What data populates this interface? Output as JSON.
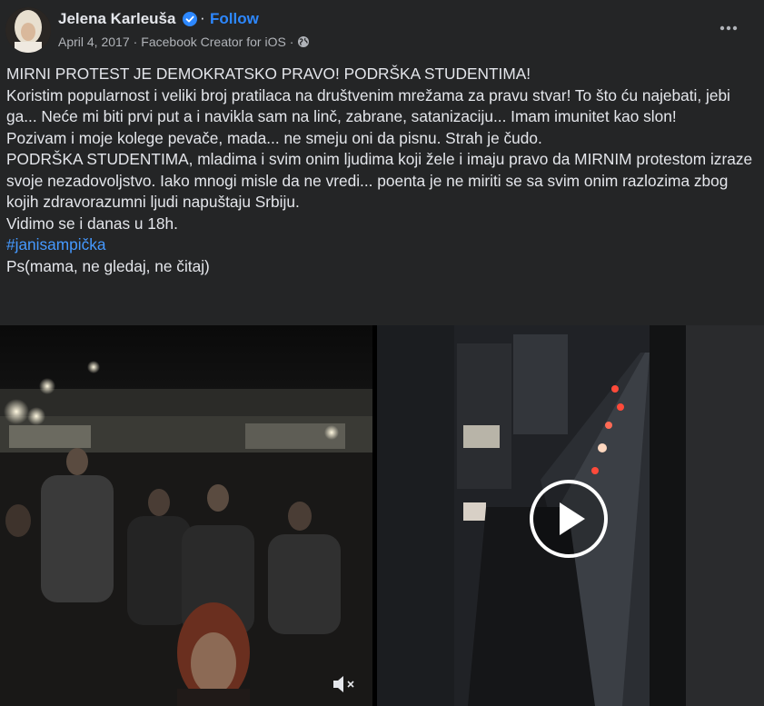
{
  "header": {
    "author": "Jelena Karleuša",
    "separator": "·",
    "follow_label": "Follow",
    "date": "April 4, 2017",
    "source": "Facebook Creator for iOS",
    "meta_sep": "·"
  },
  "post": {
    "line1": "MIRNI PROTEST JE DEMOKRATSKO PRAVO! PODRŠKA STUDENTIMA!",
    "line2": "Koristim popularnost i veliki broj pratilaca na društvenim mrežama za pravu stvar! To što ću najebati, jebi ga... Neće mi biti prvi put a i navikla sam na linč, zabrane, satanizaciju... Imam imunitet kao slon!",
    "line3": "Pozivam i moje kolege pevače, mada... ne smeju oni da pisnu. Strah je čudo.",
    "line4": "PODRŠKA STUDENTIMA, mladima i svim onim ljudima koji žele i imaju pravo da MIRNIM protestom izraze svoje nezadovoljstvo. Iako mnogi misle da ne vredi... poenta je ne miriti se sa svim onim razlozima zbog kojih zdravorazumni ljudi napuštaju Srbiju.",
    "line5": "Vidimo se i danas u 18h.",
    "hashtag": "#janisampička",
    "line6": "Ps(mama, ne gledaj, ne čitaj)"
  },
  "icons": {
    "verified": "verified-badge-icon",
    "globe": "globe-icon",
    "more": "more-options-icon",
    "mute": "muted-speaker-icon",
    "play": "play-icon"
  },
  "colors": {
    "background": "#242526",
    "text": "#e4e6eb",
    "secondary_text": "#b0b3b8",
    "accent": "#2d88ff"
  }
}
